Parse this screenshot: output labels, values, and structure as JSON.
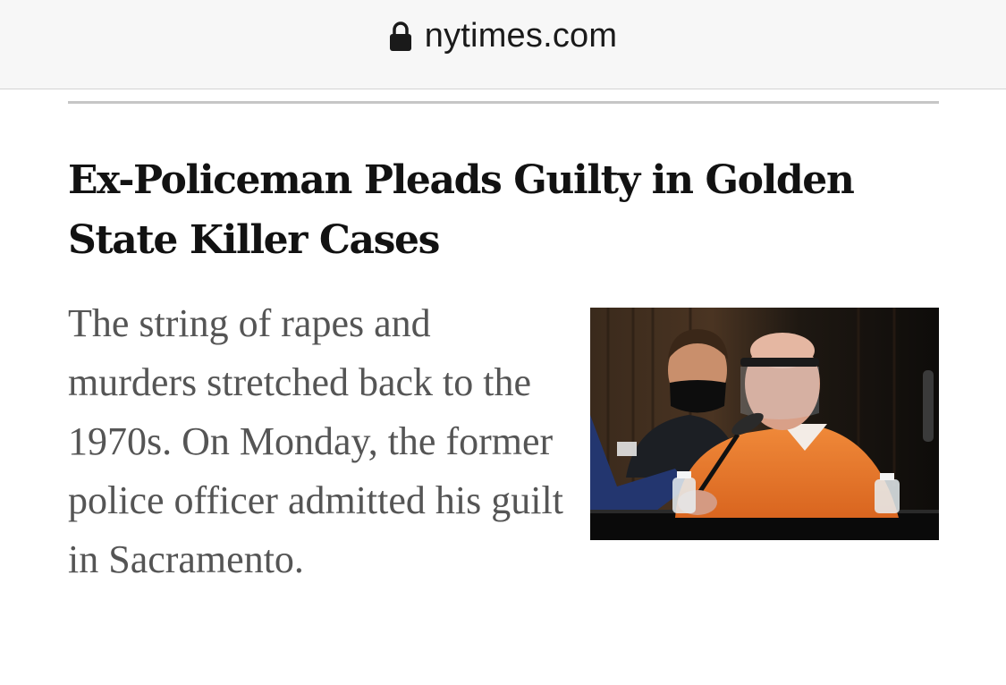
{
  "browser": {
    "url": "nytimes.com",
    "lock_icon": "lock-icon"
  },
  "article": {
    "headline": "Ex-Policeman Pleads Guilty in Golden State Killer Cases",
    "summary": "The string of rapes and murders stretched back to the 1970s. On Monday, the former police officer admitted his guilt in Sacramento."
  },
  "colors": {
    "toolbar_bg": "#f7f7f7",
    "headline": "#121212",
    "summary": "#555555",
    "jumpsuit": "#e8782a"
  }
}
